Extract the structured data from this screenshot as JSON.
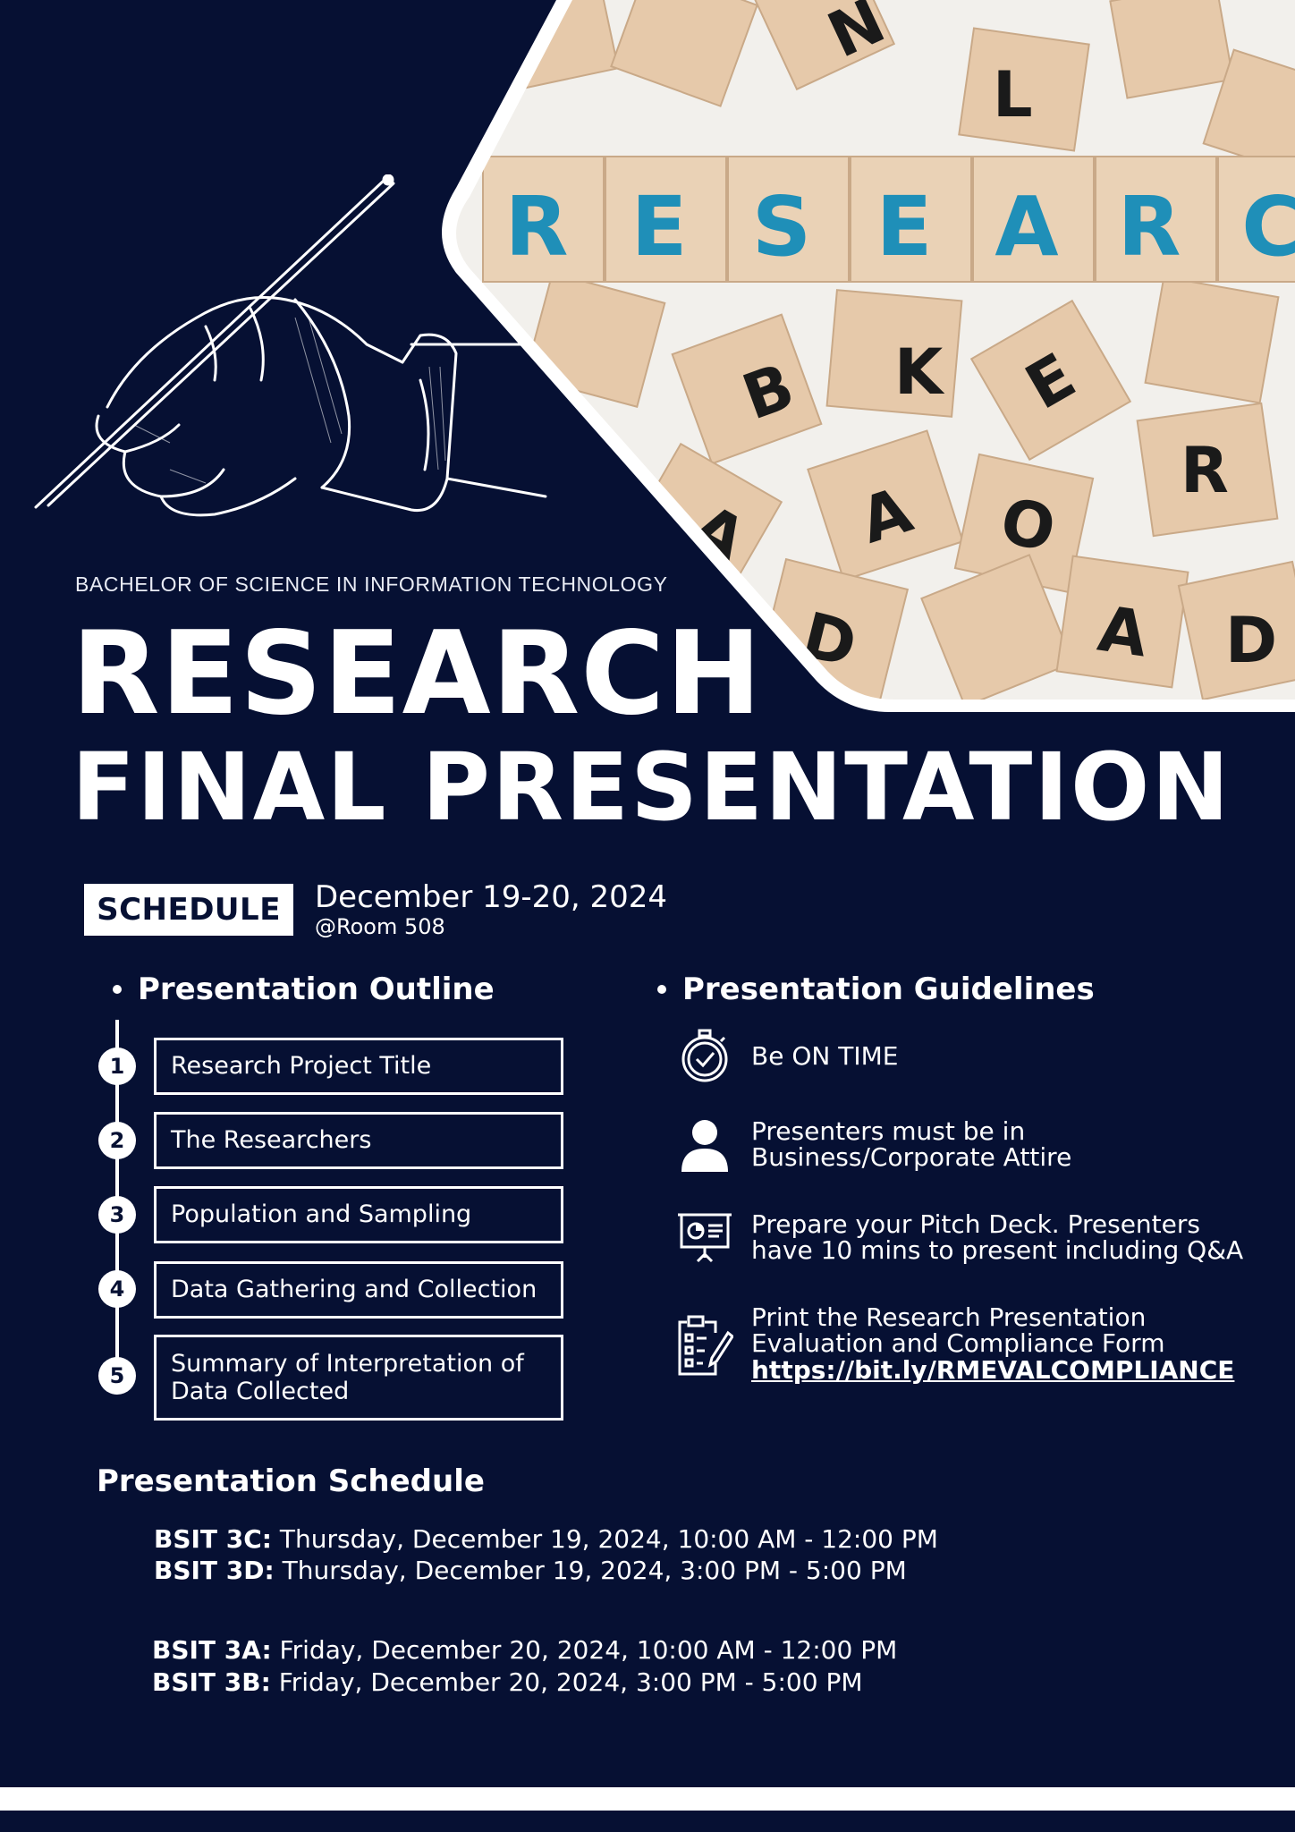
{
  "header": {
    "program": "BACHELOR OF SCIENCE IN INFORMATION TECHNOLOGY",
    "title_line1": "RESEARCH",
    "title_line2": "FINAL PRESENTATION",
    "photo_word": [
      "R",
      "E",
      "S",
      "E",
      "A",
      "R",
      "C"
    ]
  },
  "schedule": {
    "badge": "SCHEDULE",
    "date": "December 19-20, 2024",
    "room": "@Room 508"
  },
  "outline": {
    "heading": "Presentation Outline",
    "items": [
      {
        "num": "1",
        "label": "Research Project Title"
      },
      {
        "num": "2",
        "label": "The Researchers"
      },
      {
        "num": "3",
        "label": "Population and Sampling"
      },
      {
        "num": "4",
        "label": "Data Gathering and Collection"
      },
      {
        "num": "5",
        "label": "Summary of Interpretation of Data Collected"
      }
    ]
  },
  "guidelines": {
    "heading": "Presentation Guidelines",
    "items": [
      {
        "icon": "stopwatch-icon",
        "text": "Be ON TIME"
      },
      {
        "icon": "person-icon",
        "text": "Presenters must be in Business/Corporate Attire"
      },
      {
        "icon": "presentation-board-icon",
        "text": "Prepare your Pitch Deck. Presenters have 10 mins to present including Q&A"
      },
      {
        "icon": "clipboard-checklist-icon",
        "text": "Print the Research Presentation Evaluation and Compliance Form",
        "link": "https://bit.ly/RMEVALCOMPLIANCE"
      }
    ]
  },
  "presentation_schedule": {
    "heading": "Presentation Schedule",
    "rows": [
      {
        "section": "BSIT 3C:",
        "when": " Thursday, December 19, 2024, 10:00 AM - 12:00 PM"
      },
      {
        "section": "BSIT 3D:",
        "when": " Thursday, December 19, 2024, 3:00 PM - 5:00 PM"
      },
      {
        "section": "BSIT 3A:",
        "when": " Friday, December 20, 2024, 10:00 AM - 12:00 PM"
      },
      {
        "section": "BSIT 3B:",
        "when": " Friday, December 20, 2024, 3:00 PM - 5:00 PM"
      }
    ]
  },
  "colors": {
    "background": "#061033",
    "tile": "#e9cfb3",
    "tile_letter_teal": "#1f8fb8",
    "white": "#ffffff"
  }
}
